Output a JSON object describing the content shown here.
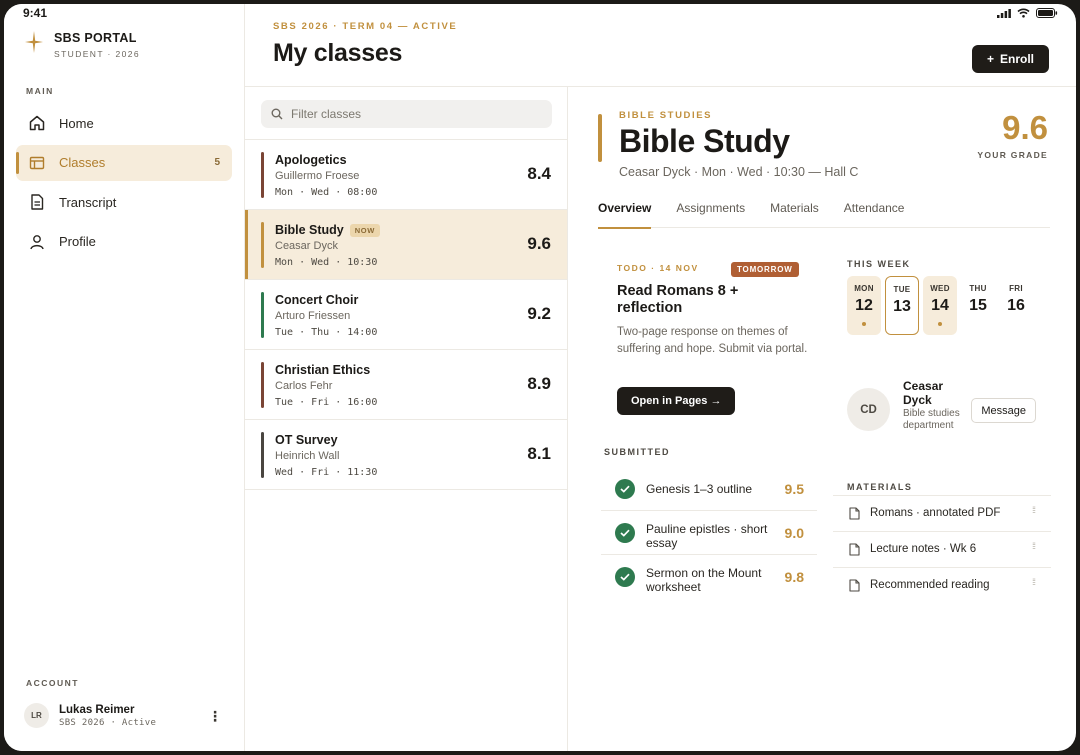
{
  "status": {
    "time": "9:41"
  },
  "brand": {
    "title": "SBS PORTAL",
    "subtitle": "STUDENT · 2026"
  },
  "sidebar": {
    "section_main": "MAIN",
    "items": [
      {
        "label": "Home",
        "icon": "home-icon"
      },
      {
        "label": "Classes",
        "icon": "classes-icon",
        "count": "5",
        "active": true
      },
      {
        "label": "Transcript",
        "icon": "document-icon"
      },
      {
        "label": "Profile",
        "icon": "person-icon"
      }
    ],
    "section_account": "ACCOUNT",
    "account": {
      "initials": "LR",
      "name": "Lukas Reimer",
      "sub": "SBS 2026 · Active"
    }
  },
  "header": {
    "eyebrow": "SBS 2026 · TERM 04 — ACTIVE",
    "title": "My classes",
    "enroll_label": "Enroll"
  },
  "filter": {
    "placeholder": "Filter classes"
  },
  "classes": [
    {
      "name": "Apologetics",
      "teacher": "Guillermo Froese",
      "schedule": "Mon · Wed · 08:00",
      "grade": "8.4",
      "color": "#7a4535",
      "badge": ""
    },
    {
      "name": "Bible Study",
      "teacher": "Ceasar Dyck",
      "schedule": "Mon · Wed · 10:30",
      "grade": "9.6",
      "color": "#c1903e",
      "badge": "NOW"
    },
    {
      "name": "Concert Choir",
      "teacher": "Arturo Friessen",
      "schedule": "Tue · Thu · 14:00",
      "grade": "9.2",
      "color": "#2e7a4f",
      "badge": ""
    },
    {
      "name": "Christian Ethics",
      "teacher": "Carlos Fehr",
      "schedule": "Tue · Fri · 16:00",
      "grade": "8.9",
      "color": "#7a4535",
      "badge": ""
    },
    {
      "name": "OT Survey",
      "teacher": "Heinrich Wall",
      "schedule": "Wed · Fri · 11:30",
      "grade": "8.1",
      "color": "#4a4640",
      "badge": ""
    }
  ],
  "detail": {
    "eyebrow": "BIBLE STUDIES",
    "title": "Bible Study",
    "meta": "Ceasar Dyck · Mon · Wed · 10:30 — Hall C",
    "grade": "9.6",
    "grade_label": "YOUR GRADE",
    "tabs": [
      "Overview",
      "Assignments",
      "Materials",
      "Attendance"
    ],
    "todo": {
      "eyebrow": "TODO · 14 NOV",
      "badge": "TOMORROW",
      "title": "Read Romans 8 + reflection",
      "description": "Two-page response on themes of suffering and hope. Submit via portal.",
      "button": "Open in Pages →"
    },
    "submitted_label": "SUBMITTED",
    "submitted": [
      {
        "name": "Genesis 1–3 outline",
        "score": "9.5"
      },
      {
        "name": "Pauline epistles · short essay",
        "score": "9.0"
      },
      {
        "name": "Sermon on the Mount worksheet",
        "score": "9.8"
      }
    ],
    "week_label": "THIS WEEK",
    "week": [
      {
        "day": "MON",
        "num": "12",
        "style": "hl",
        "dot": true
      },
      {
        "day": "TUE",
        "num": "13",
        "style": "today",
        "dot": false
      },
      {
        "day": "WED",
        "num": "14",
        "style": "hl",
        "dot": true
      },
      {
        "day": "THU",
        "num": "15",
        "style": "",
        "dot": false
      },
      {
        "day": "FRI",
        "num": "16",
        "style": "",
        "dot": false
      }
    ],
    "teacher": {
      "initials": "CD",
      "name": "Ceasar Dyck",
      "dept": "Bible studies department",
      "message_label": "Message"
    },
    "materials_label": "MATERIALS",
    "materials": [
      "Romans · annotated PDF",
      "Lecture notes · Wk 6",
      "Recommended reading"
    ]
  },
  "colors": {
    "accent": "#c1903e",
    "dark": "#1f1c18",
    "success": "#2e7a4f",
    "warning": "#b05f34"
  }
}
